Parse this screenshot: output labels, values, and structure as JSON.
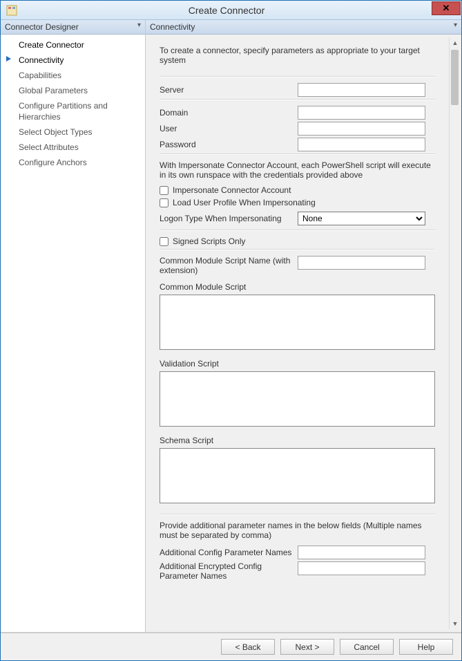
{
  "window": {
    "title": "Create Connector"
  },
  "nav": {
    "header": "Connector Designer",
    "items": [
      {
        "label": "Create Connector",
        "primary": true
      },
      {
        "label": "Connectivity",
        "active": true
      },
      {
        "label": "Capabilities"
      },
      {
        "label": "Global Parameters"
      },
      {
        "label": "Configure Partitions and Hierarchies"
      },
      {
        "label": "Select Object Types"
      },
      {
        "label": "Select Attributes"
      },
      {
        "label": "Configure Anchors"
      }
    ]
  },
  "content": {
    "header": "Connectivity",
    "intro": "To create a connector, specify parameters as appropriate to your target system",
    "server_label": "Server",
    "server_value": "",
    "domain_label": "Domain",
    "domain_value": "",
    "user_label": "User",
    "user_value": "",
    "password_label": "Password",
    "password_value": "",
    "impersonate_note": "With Impersonate Connector Account, each PowerShell script will execute in its own runspace with the credentials provided above",
    "cb_impersonate_label": "Impersonate Connector Account",
    "cb_loadprofile_label": "Load User Profile When Impersonating",
    "logontype_label": "Logon Type When Impersonating",
    "logontype_selected": "None",
    "logontype_options": [
      "None"
    ],
    "cb_signedscripts_label": "Signed Scripts Only",
    "common_name_label": "Common Module Script Name (with extension)",
    "common_name_value": "",
    "common_script_label": "Common Module Script",
    "validation_script_label": "Validation Script",
    "schema_script_label": "Schema Script",
    "additional_note": "Provide additional parameter names in the below fields (Multiple names must be separated by comma)",
    "add_config_label": "Additional Config Parameter Names",
    "add_config_value": "",
    "add_encrypted_label": "Additional Encrypted Config Parameter Names",
    "add_encrypted_value": ""
  },
  "buttons": {
    "back": "<  Back",
    "next": "Next  >",
    "cancel": "Cancel",
    "help": "Help"
  }
}
